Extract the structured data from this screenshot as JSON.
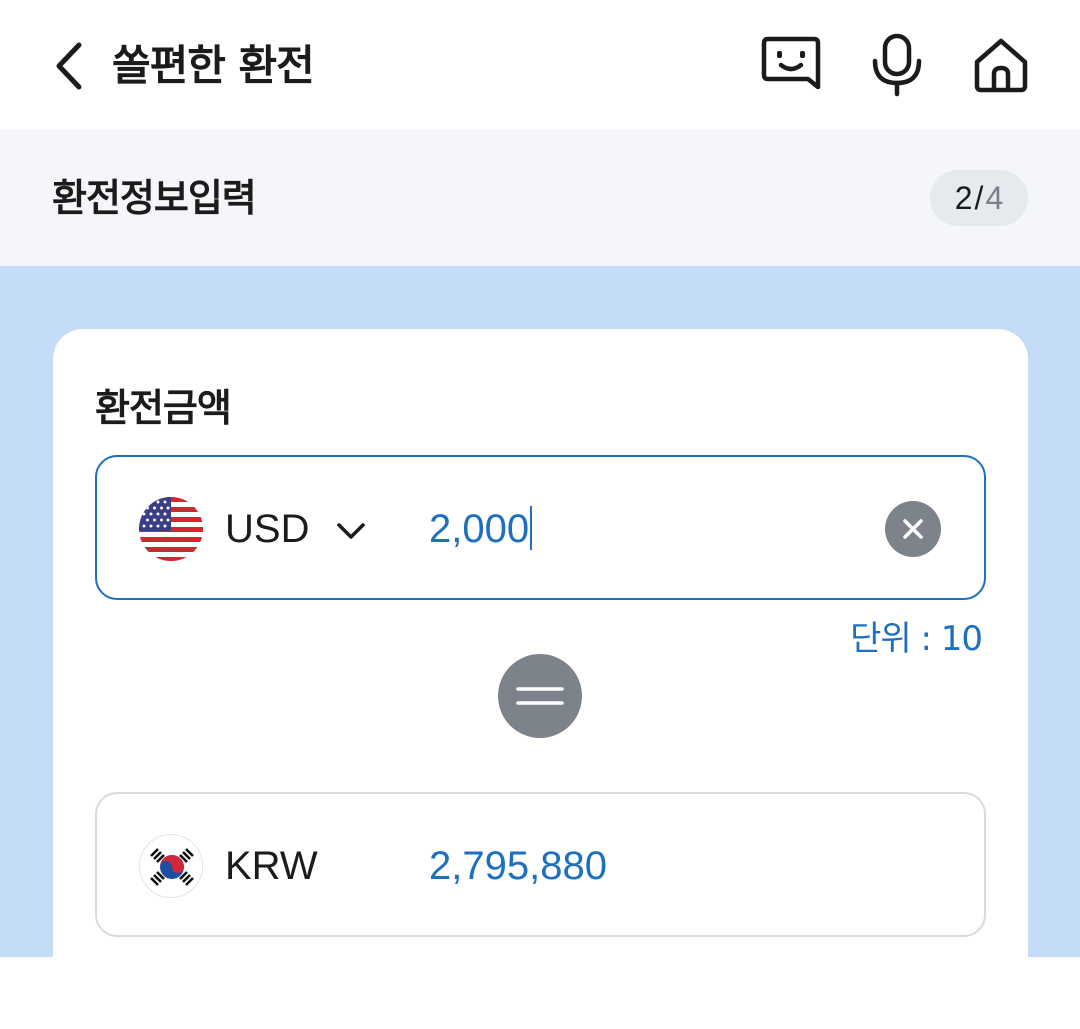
{
  "header": {
    "title": "쏠편한 환전",
    "icons": {
      "back": "chevron-left-icon",
      "chatbot": "chatbot-icon",
      "mic": "mic-icon",
      "home": "home-icon"
    }
  },
  "step": {
    "title": "환전정보입력",
    "current": "2",
    "separator": "/",
    "total": "4"
  },
  "exchange": {
    "section_label": "환전금액",
    "from": {
      "currency": "USD",
      "amount": "2,000",
      "flag_icon": "us-flag-icon"
    },
    "unit_note": "단위 : 10",
    "to": {
      "currency": "KRW",
      "amount": "2,795,880",
      "flag_icon": "kr-flag-icon"
    }
  },
  "colors": {
    "accent": "#1d6fbf",
    "content_background": "#c4dcf8",
    "step_background": "#f4f6f9",
    "icon_gray": "#7c838b"
  }
}
